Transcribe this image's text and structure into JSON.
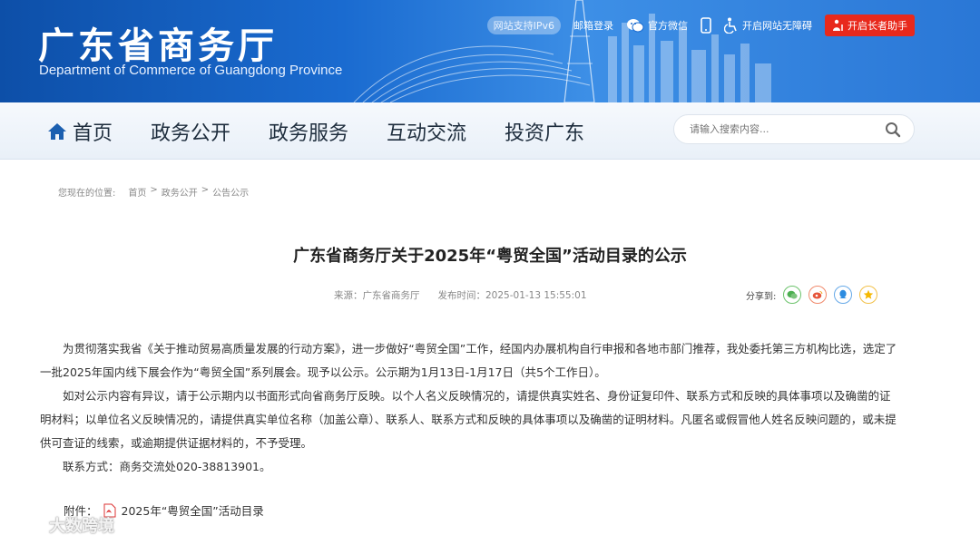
{
  "header": {
    "site_name_cn": "广东省商务厅",
    "site_name_en": "Department of Commerce of Guangdong Province",
    "ipv6_badge": "网站支持IPv6",
    "links": {
      "mail_login": "邮箱登录",
      "wechat": "官方微信",
      "accessibility": "开启网站无障碍",
      "elder_mode": "开启长者助手"
    }
  },
  "nav": {
    "items": [
      "首页",
      "政务公开",
      "政务服务",
      "互动交流",
      "投资广东"
    ],
    "search_placeholder": "请输入搜索内容..."
  },
  "breadcrumb": {
    "prefix": "您现在的位置:",
    "items": [
      "首页",
      "政务公开",
      "公告公示"
    ],
    "separator": ">"
  },
  "article": {
    "title": "广东省商务厅关于2025年“粤贸全国”活动目录的公示",
    "source": "来源：广东省商务厅",
    "publish_time": "发布时间：2025-01-13 15:55:01",
    "share_label": "分享到:",
    "paragraphs": [
      "为贯彻落实我省《关于推动贸易高质量发展的行动方案》，进一步做好“粤贸全国”工作，经国内办展机构自行申报和各地市部门推荐，我处委托第三方机构比选，选定了一批2025年国内线下展会作为“粤贸全国”系列展会。现予以公示。公示期为1月13日-1月17日（共5个工作日）。",
      "如对公示内容有异议，请于公示期内以书面形式向省商务厅反映。以个人名义反映情况的，请提供真实姓名、身份证复印件、联系方式和反映的具体事项以及确凿的证明材料；以单位名义反映情况的，请提供真实单位名称（加盖公章）、联系人、联系方式和反映的具体事项以及确凿的证明材料。凡匿名或假冒他人姓名反映问题的，或未提供可查证的线索，或逾期提供证据材料的，不予受理。",
      "联系方式：商务交流处020-38813901。"
    ],
    "attachment_label": "附件：",
    "attachment_name": "2025年“粤贸全国”活动目录"
  },
  "watermark": "大数跨境",
  "colors": {
    "banner": "#1a6bd0",
    "elder_button": "#e8291c",
    "nav_text": "#1e2d3d"
  }
}
